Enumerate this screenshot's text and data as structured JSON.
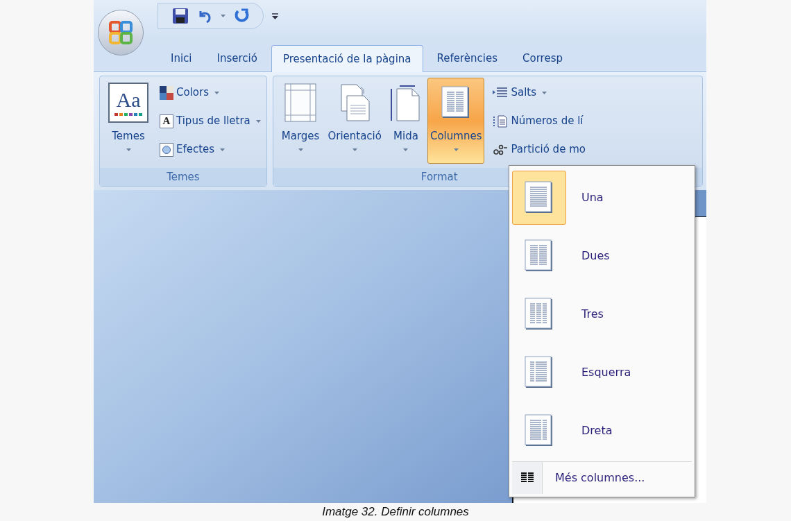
{
  "tabs": [
    {
      "label": "Inici",
      "selected": false
    },
    {
      "label": "Inserció",
      "selected": false
    },
    {
      "label": "Presentació de la pàgina",
      "selected": true
    },
    {
      "label": "Referències",
      "selected": false
    },
    {
      "label": "Corresp",
      "selected": false
    }
  ],
  "groups": [
    {
      "label": "Temes",
      "large": [
        {
          "label": "Temes",
          "kind": "themes",
          "icon_text": "Aa",
          "dropdown": true,
          "pressed": false
        }
      ],
      "small": [
        {
          "label": "Colors",
          "kind": "colors",
          "dropdown": true
        },
        {
          "label": "Tipus de lletra",
          "kind": "fonts",
          "icon_text": "A",
          "dropdown": true
        },
        {
          "label": "Efectes",
          "kind": "effects",
          "dropdown": true
        }
      ]
    },
    {
      "label": "Format",
      "large": [
        {
          "label": "Marges",
          "kind": "margins",
          "dropdown": true,
          "pressed": false
        },
        {
          "label": "Orientació",
          "kind": "orientation",
          "dropdown": true,
          "pressed": false
        },
        {
          "label": "Mida",
          "kind": "size",
          "dropdown": true,
          "pressed": false
        },
        {
          "label": "Columnes",
          "kind": "columns",
          "dropdown": true,
          "pressed": true
        }
      ],
      "small": [
        {
          "label": "Salts",
          "kind": "breaks",
          "dropdown": true
        },
        {
          "label": "Números de lí",
          "kind": "linenumbers",
          "dropdown": false
        },
        {
          "label": "Partició de mo",
          "kind": "hyphenation",
          "dropdown": false
        }
      ]
    }
  ],
  "menu": {
    "items": [
      {
        "label": "Una",
        "kind": "one",
        "selected": true
      },
      {
        "label": "Dues",
        "kind": "two",
        "selected": false
      },
      {
        "label": "Tres",
        "kind": "three",
        "selected": false
      },
      {
        "label": "Esquerra",
        "kind": "left",
        "selected": false
      },
      {
        "label": "Dreta",
        "kind": "right",
        "selected": false
      }
    ],
    "footer": "Més columnes..."
  },
  "caption": "Imatge 32. Definir columnes"
}
